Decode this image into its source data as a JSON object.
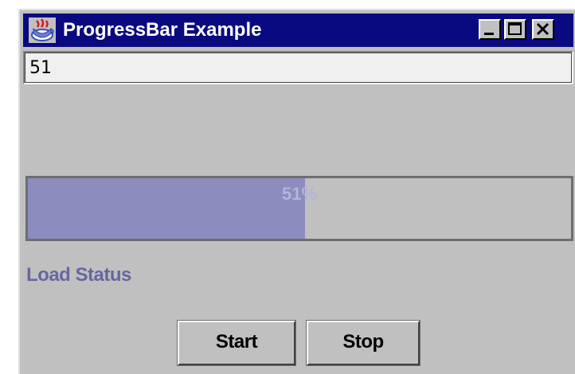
{
  "window": {
    "title": "ProgressBar Example",
    "icon": "java-cup-icon",
    "controls": [
      "minimize-icon",
      "maximize-icon",
      "close-icon"
    ]
  },
  "textfield": {
    "value": "51"
  },
  "progress": {
    "value": 51,
    "label": "51%",
    "fill_color": "#8c8cbf"
  },
  "status": {
    "label": "Load Status"
  },
  "buttons": {
    "start_label": "Start",
    "stop_label": "Stop"
  }
}
